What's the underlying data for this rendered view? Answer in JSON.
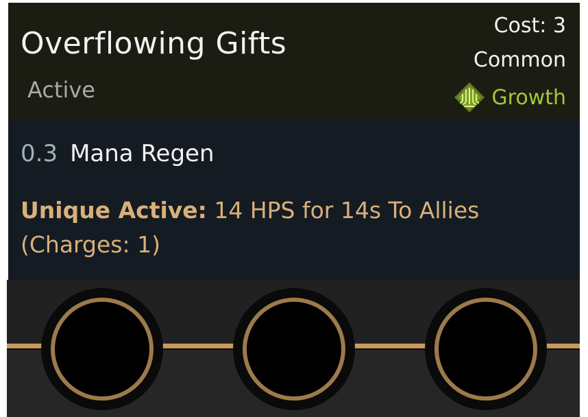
{
  "item": {
    "name": "Overflowing Gifts",
    "type": "Active",
    "cost": "Cost: 3",
    "rarity": "Common",
    "path": {
      "icon": "growth-emblem-icon",
      "label": "Growth",
      "color": "#a2c739"
    }
  },
  "stat": {
    "value": "0.3",
    "label": "Mana Regen"
  },
  "ability": {
    "keyword": "Unique Active:",
    "text": " 14 HPS for 14s To Allies (Charges: 1)",
    "color": "#d9b07a"
  },
  "slots": [
    {
      "name": "socket-1"
    },
    {
      "name": "socket-2"
    },
    {
      "name": "socket-3"
    }
  ]
}
